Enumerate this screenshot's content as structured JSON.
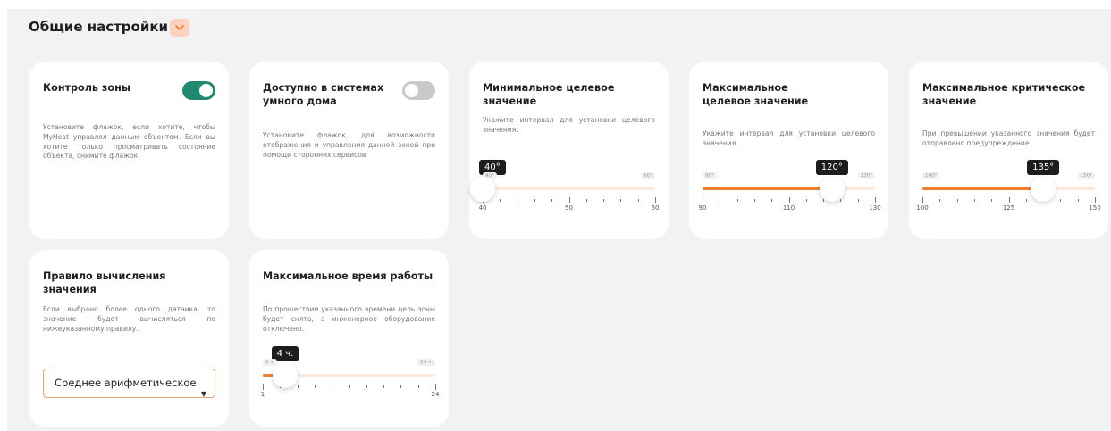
{
  "section": {
    "title": "Общие настройки",
    "collapse_icon": "chevron-down-icon",
    "accent": "#f07f2e"
  },
  "cards": {
    "zone": {
      "title": "Контроль зоны",
      "description": "Установите флажок, если хотите, чтобы MyHeat управлял данным объектом. Если вы хотите только просматривать состояние объекта, снимите флажок.",
      "enabled": true,
      "toggle_color": "#1f8a6f"
    },
    "smart": {
      "title": "Доступно в системах умного дома",
      "description": "Установите флажок, для возможности отображения и управления данной зоной при помощи сторонних сервисов",
      "enabled": false
    },
    "min_target": {
      "title": "Минимальное целевое значение",
      "description": "Укажите интервал для установки целевого значения.",
      "value": 40,
      "value_label": "40°",
      "min": 40,
      "max": 60,
      "min_label": "40°",
      "max_label": "60°",
      "tick_labels": [
        "40",
        "50",
        "60"
      ],
      "tick_values": [
        40,
        50,
        60
      ]
    },
    "max_target": {
      "title": "Максимальное целевое значение",
      "description": "Укажите интервал для установки целевого значения.",
      "value": 120,
      "value_label": "120°",
      "min": 90,
      "max": 130,
      "min_label": "90°",
      "max_label": "130°",
      "tick_labels": [
        "90",
        "110",
        "130"
      ],
      "tick_values": [
        90,
        110,
        130
      ]
    },
    "max_critical": {
      "title": "Максимальное критическое значение",
      "description": "При превышении указанного значения будет отправлено предупреждение.",
      "value": 135,
      "value_label": "135°",
      "min": 100,
      "max": 150,
      "min_label": "100°",
      "max_label": "150°",
      "tick_labels": [
        "100",
        "125",
        "150"
      ],
      "tick_values": [
        100,
        125,
        150
      ]
    },
    "rule": {
      "title": "Правило вычисления значения",
      "description": "Если выбрано более одного датчика, то значение будет вычисляться по нижеуказанному правилу.",
      "selected": "Среднее арифметическое"
    },
    "max_time": {
      "title": "Максимальное время работы",
      "description": "По прошествии указанного времени цель зоны будет снята, а инженерное оборудование отключено.",
      "value": 4,
      "value_label": "4 ч.",
      "min": 1,
      "max": 24,
      "min_label": "1 ч.",
      "max_label": "24 ч.",
      "tick_labels": [
        "1",
        "24"
      ],
      "tick_values": [
        1,
        24
      ]
    }
  }
}
